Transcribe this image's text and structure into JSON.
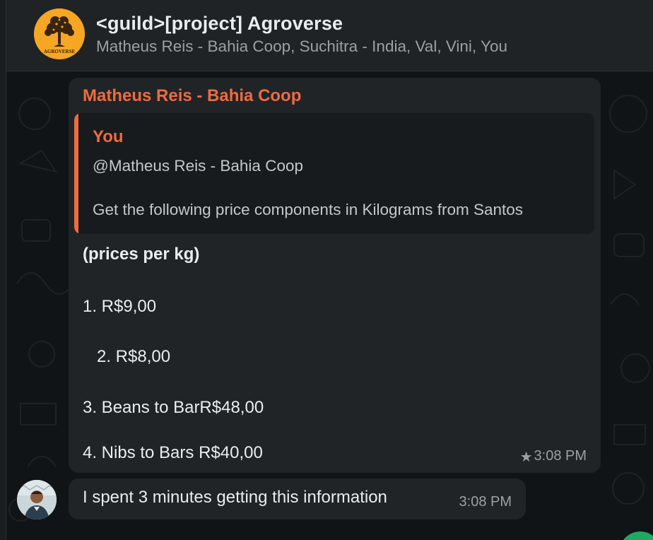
{
  "header": {
    "title": "<guild>[project] Agroverse",
    "members": "Matheus Reis - Bahia Coop, Suchitra - India, Val, Vini, You",
    "avatar_text": "AGROVERSE"
  },
  "message1": {
    "sender": "Matheus Reis - Bahia Coop",
    "quote": {
      "author": "You",
      "line1": "@Matheus Reis - Bahia Coop",
      "line2": "Get the following price components in Kilograms from Santos"
    },
    "heading": "(prices per kg)",
    "lines": [
      "1. R$9,00",
      "2.  R$8,00",
      "3. Beans to BarR$48,00",
      "4. Nibs to Bars R$40,00"
    ],
    "time": "3:08 PM",
    "starred": true,
    "icon": "star-icon"
  },
  "message2": {
    "text": "I spent 3 minutes getting this information",
    "time": "3:08 PM"
  },
  "colors": {
    "accent": "#f06a3f",
    "bubble": "#202427",
    "header": "#1f2326",
    "badge": "#1dab61"
  }
}
